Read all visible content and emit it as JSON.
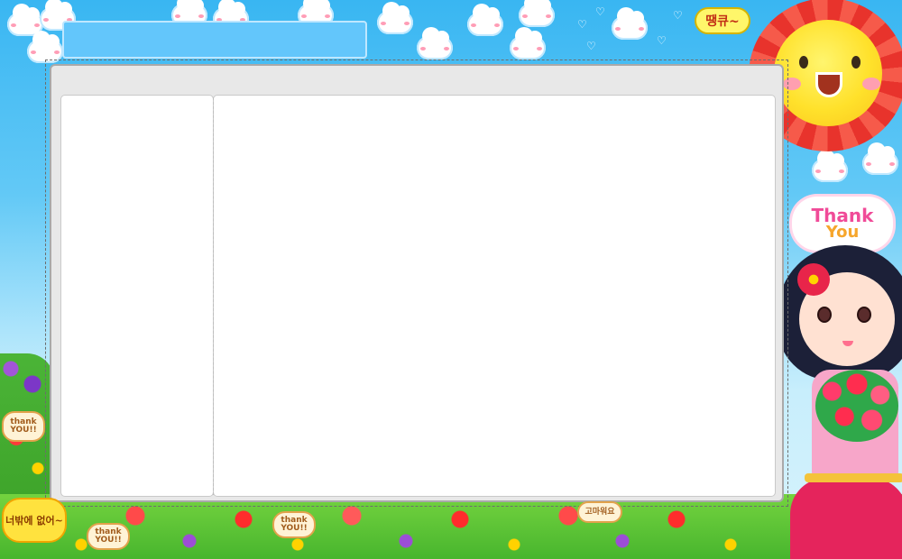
{
  "bubble": {
    "text": "땡큐~"
  },
  "thank_sign": {
    "line1": "Thank",
    "line2": "You"
  },
  "stickers": {
    "left_thank": "thank YOU!!",
    "left_yellow": "너밖에 없어~",
    "bottom_thank1": "thank YOU!!",
    "bottom_thank2": "thank YOU!!",
    "bottom_thanks_ko": "고마워요"
  },
  "colors": {
    "sky_top": "#39b6f2",
    "frame_bg": "#e8e8e8",
    "top_bar": "#63c6fb",
    "panel_bg": "#ffffff"
  },
  "icons": {
    "sun": "sun-icon",
    "heart": "heart-icon",
    "cloud": "cloud-icon"
  }
}
